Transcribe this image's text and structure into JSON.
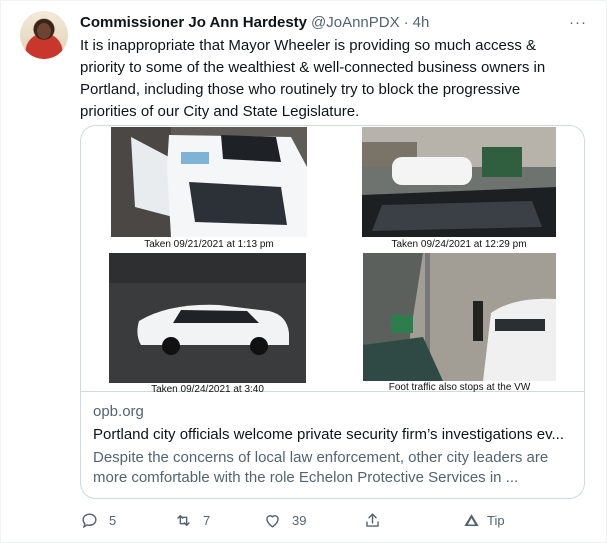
{
  "tweet": {
    "author_name": "Commissioner Jo Ann Hardesty",
    "handle": "@JoAnnPDX",
    "separator": "·",
    "time": "4h",
    "more": "···",
    "text": "It is inappropriate that Mayor Wheeler is providing so much access & priority to some of the wealthiest & well-connected business owners in Portland, including those who routinely try to block the progressive priorities of our City and State Legislature."
  },
  "card": {
    "captions": [
      "Taken 09/21/2021 at 1:13 pm",
      "Taken 09/24/2021 at 12:29 pm",
      "Taken 09/24/2021 at 3:40",
      "Foot traffic also stops at the VW"
    ],
    "domain": "opb.org",
    "title": "Portland city officials welcome private security firm’s investigations ev...",
    "description": "Despite the concerns of local law enforcement, other city leaders are more comfortable with the role Echelon Protective Services in ..."
  },
  "actions": {
    "replies": "5",
    "retweets": "7",
    "likes": "39",
    "tip": "Tip"
  },
  "colors": {
    "text": "#0f1419",
    "secondary": "#536471",
    "border": "#cfd9de"
  }
}
